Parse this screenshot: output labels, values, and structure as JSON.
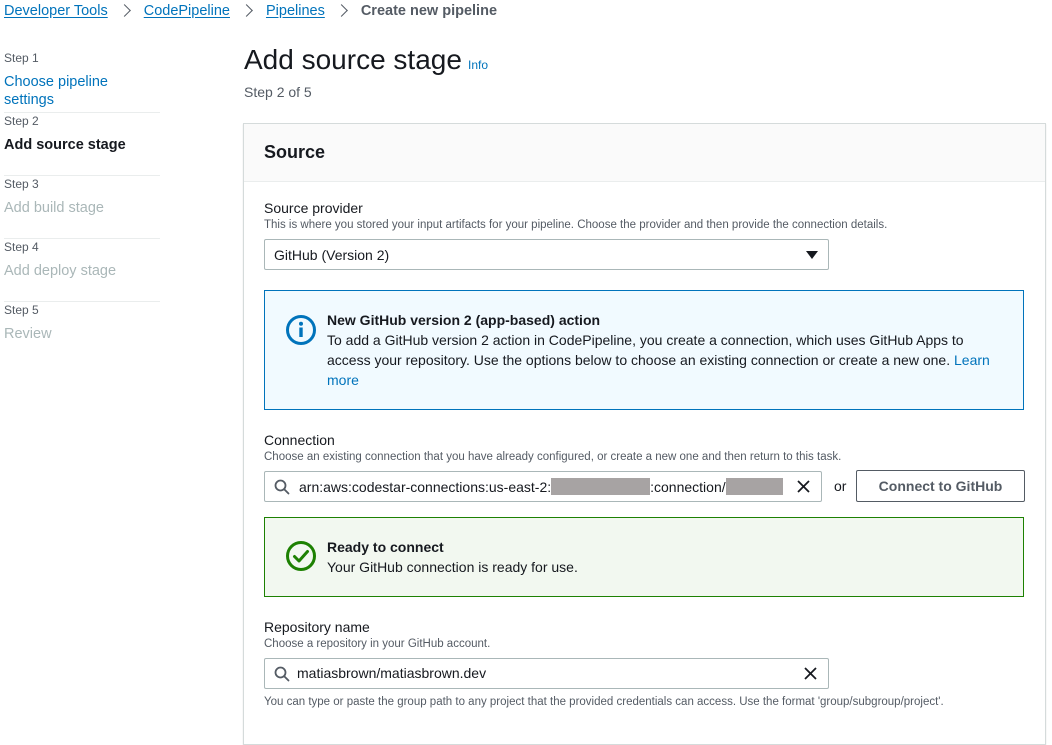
{
  "breadcrumb": {
    "items": [
      "Developer Tools",
      "CodePipeline",
      "Pipelines"
    ],
    "current": "Create new pipeline"
  },
  "steps": [
    {
      "step": "Step 1",
      "label": "Choose pipeline settings",
      "state": "done"
    },
    {
      "step": "Step 2",
      "label": "Add source stage",
      "state": "active"
    },
    {
      "step": "Step 3",
      "label": "Add build stage",
      "state": "todo"
    },
    {
      "step": "Step 4",
      "label": "Add deploy stage",
      "state": "todo"
    },
    {
      "step": "Step 5",
      "label": "Review",
      "state": "todo"
    }
  ],
  "header": {
    "title": "Add source stage",
    "info": "Info",
    "step_of": "Step 2 of 5"
  },
  "source": {
    "title": "Source",
    "provider_label": "Source provider",
    "provider_desc": "This is where you stored your input artifacts for your pipeline. Choose the provider and then provide the connection details.",
    "provider_value": "GitHub (Version 2)",
    "info_alert": {
      "title": "New GitHub version 2 (app-based) action",
      "body": "To add a GitHub version 2 action in CodePipeline, you create a connection, which uses GitHub Apps to access your repository. Use the options below to choose an existing connection or create a new one. ",
      "link": "Learn more"
    },
    "connection_label": "Connection",
    "connection_desc": "Choose an existing connection that you have already configured, or create a new one and then return to this task.",
    "connection_prefix": "arn:aws:codestar-connections:us-east-2:",
    "connection_middle": ":connection/",
    "or_text": "or",
    "connect_button": "Connect to GitHub",
    "success_alert": {
      "title": "Ready to connect",
      "body": "Your GitHub connection is ready for use."
    },
    "repo_label": "Repository name",
    "repo_desc": "Choose a repository in your GitHub account.",
    "repo_value": "matiasbrown/matiasbrown.dev",
    "repo_help": "You can type or paste the group path to any project that the provided credentials can access. Use the format 'group/subgroup/project'."
  },
  "colors": {
    "link": "#0073bb",
    "info_border": "#0073bb",
    "info_bg": "#f1faff",
    "success_border": "#1d8102",
    "success_bg": "#f2f8f0"
  }
}
